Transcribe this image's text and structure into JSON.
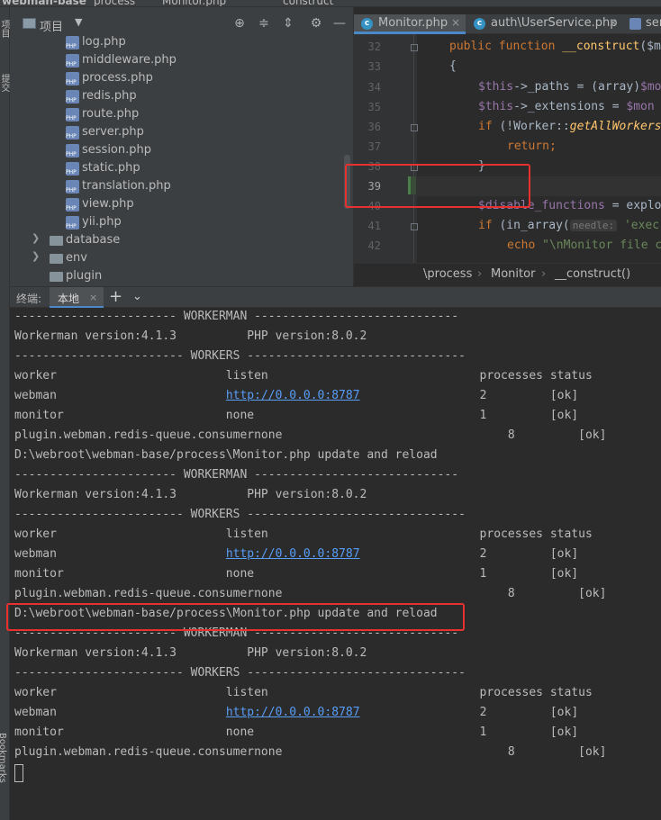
{
  "topbar": {
    "items": [
      "webman-base",
      "process",
      "Monitor.php",
      "__construct"
    ]
  },
  "stripe": {
    "top_label": "项目",
    "mid_label": "提交",
    "bottom_label": "Bookmarks"
  },
  "project": {
    "title": "项目",
    "tools": [
      "crosshair-icon",
      "collapse-icon",
      "expand-icon",
      "gear-icon",
      "minimize-icon"
    ],
    "files": [
      "log.php",
      "middleware.php",
      "process.php",
      "redis.php",
      "route.php",
      "server.php",
      "session.php",
      "static.php",
      "translation.php",
      "view.php",
      "yii.php"
    ],
    "folders": [
      {
        "name": "database",
        "expandable": true
      },
      {
        "name": "env",
        "expandable": true
      },
      {
        "name": "plugin",
        "expandable": false
      }
    ]
  },
  "editor": {
    "tabs": [
      {
        "label": "Monitor.php",
        "active": true
      },
      {
        "label": "auth\\UserService.php",
        "active": false
      },
      {
        "label": "ser",
        "active": false
      }
    ],
    "line_numbers": [
      "32",
      "33",
      "34",
      "35",
      "36",
      "37",
      "38",
      "39",
      "40",
      "41",
      "42"
    ],
    "current_line": "39",
    "code": {
      "l32_kw1": "public ",
      "l32_kw2": "function ",
      "l32_fn": "__construct",
      "l32_rest": "($m",
      "l33": "{",
      "l34_var": "$this",
      "l34_rest": "->_paths = (array)",
      "l34_var2": "$mo",
      "l35_var": "$this",
      "l35_rest": "->_extensions = ",
      "l35_var2": "$mon",
      "l36_kw": "if ",
      "l36_a": "(!Worker::",
      "l36_it": "getAllWorkers",
      "l37_kw": "return",
      "l37_rest": ";",
      "l38": "}",
      "l40_var": "$disable_functions",
      "l40_rest": " = explo",
      "l41_kw": "if ",
      "l41_a": "(in_array(",
      "l41_hint": "needle:",
      "l41_str": " 'exec",
      "l42_kw": "echo ",
      "l42_str": "\"\\nMonitor file c"
    },
    "breadcrumb": [
      "\\process",
      "Monitor",
      "__construct()"
    ]
  },
  "terminal_header": {
    "label": "终端:",
    "tab": "本地",
    "close": "×",
    "plus": "+",
    "chevron": "⌄"
  },
  "terminal": {
    "lines": [
      "----------------------- WORKERMAN -----------------------------",
      "Workerman version:4.1.3          PHP version:8.0.2",
      "------------------------ WORKERS -------------------------------",
      "worker                        listen                              processes status",
      "webman                        http://0.0.0.0:8787                 2         [ok]",
      "monitor                       none                                1         [ok]",
      "plugin.webman.redis-queue.consumernone                                8         [ok]",
      "D:\\webroot\\webman-base/process\\Monitor.php update and reload",
      "----------------------- WORKERMAN -----------------------------",
      "Workerman version:4.1.3          PHP version:8.0.2",
      "------------------------ WORKERS -------------------------------",
      "worker                        listen                              processes status",
      "webman                        http://0.0.0.0:8787                 2         [ok]",
      "monitor                       none                                1         [ok]",
      "plugin.webman.redis-queue.consumernone                                8         [ok]",
      "D:\\webroot\\webman-base/process\\Monitor.php update and reload",
      "----------------------- WORKERMAN -----------------------------",
      "Workerman version:4.1.3          PHP version:8.0.2",
      "------------------------ WORKERS -------------------------------",
      "worker                        listen                              processes status",
      "webman                        http://0.0.0.0:8787                 2         [ok]",
      "monitor                       none                                1         [ok]",
      "plugin.webman.redis-queue.consumernone                                8         [ok]"
    ],
    "webman_label": "webman",
    "url": "http://0.0.0.0:8787",
    "webman_tail": "2         [ok]"
  }
}
